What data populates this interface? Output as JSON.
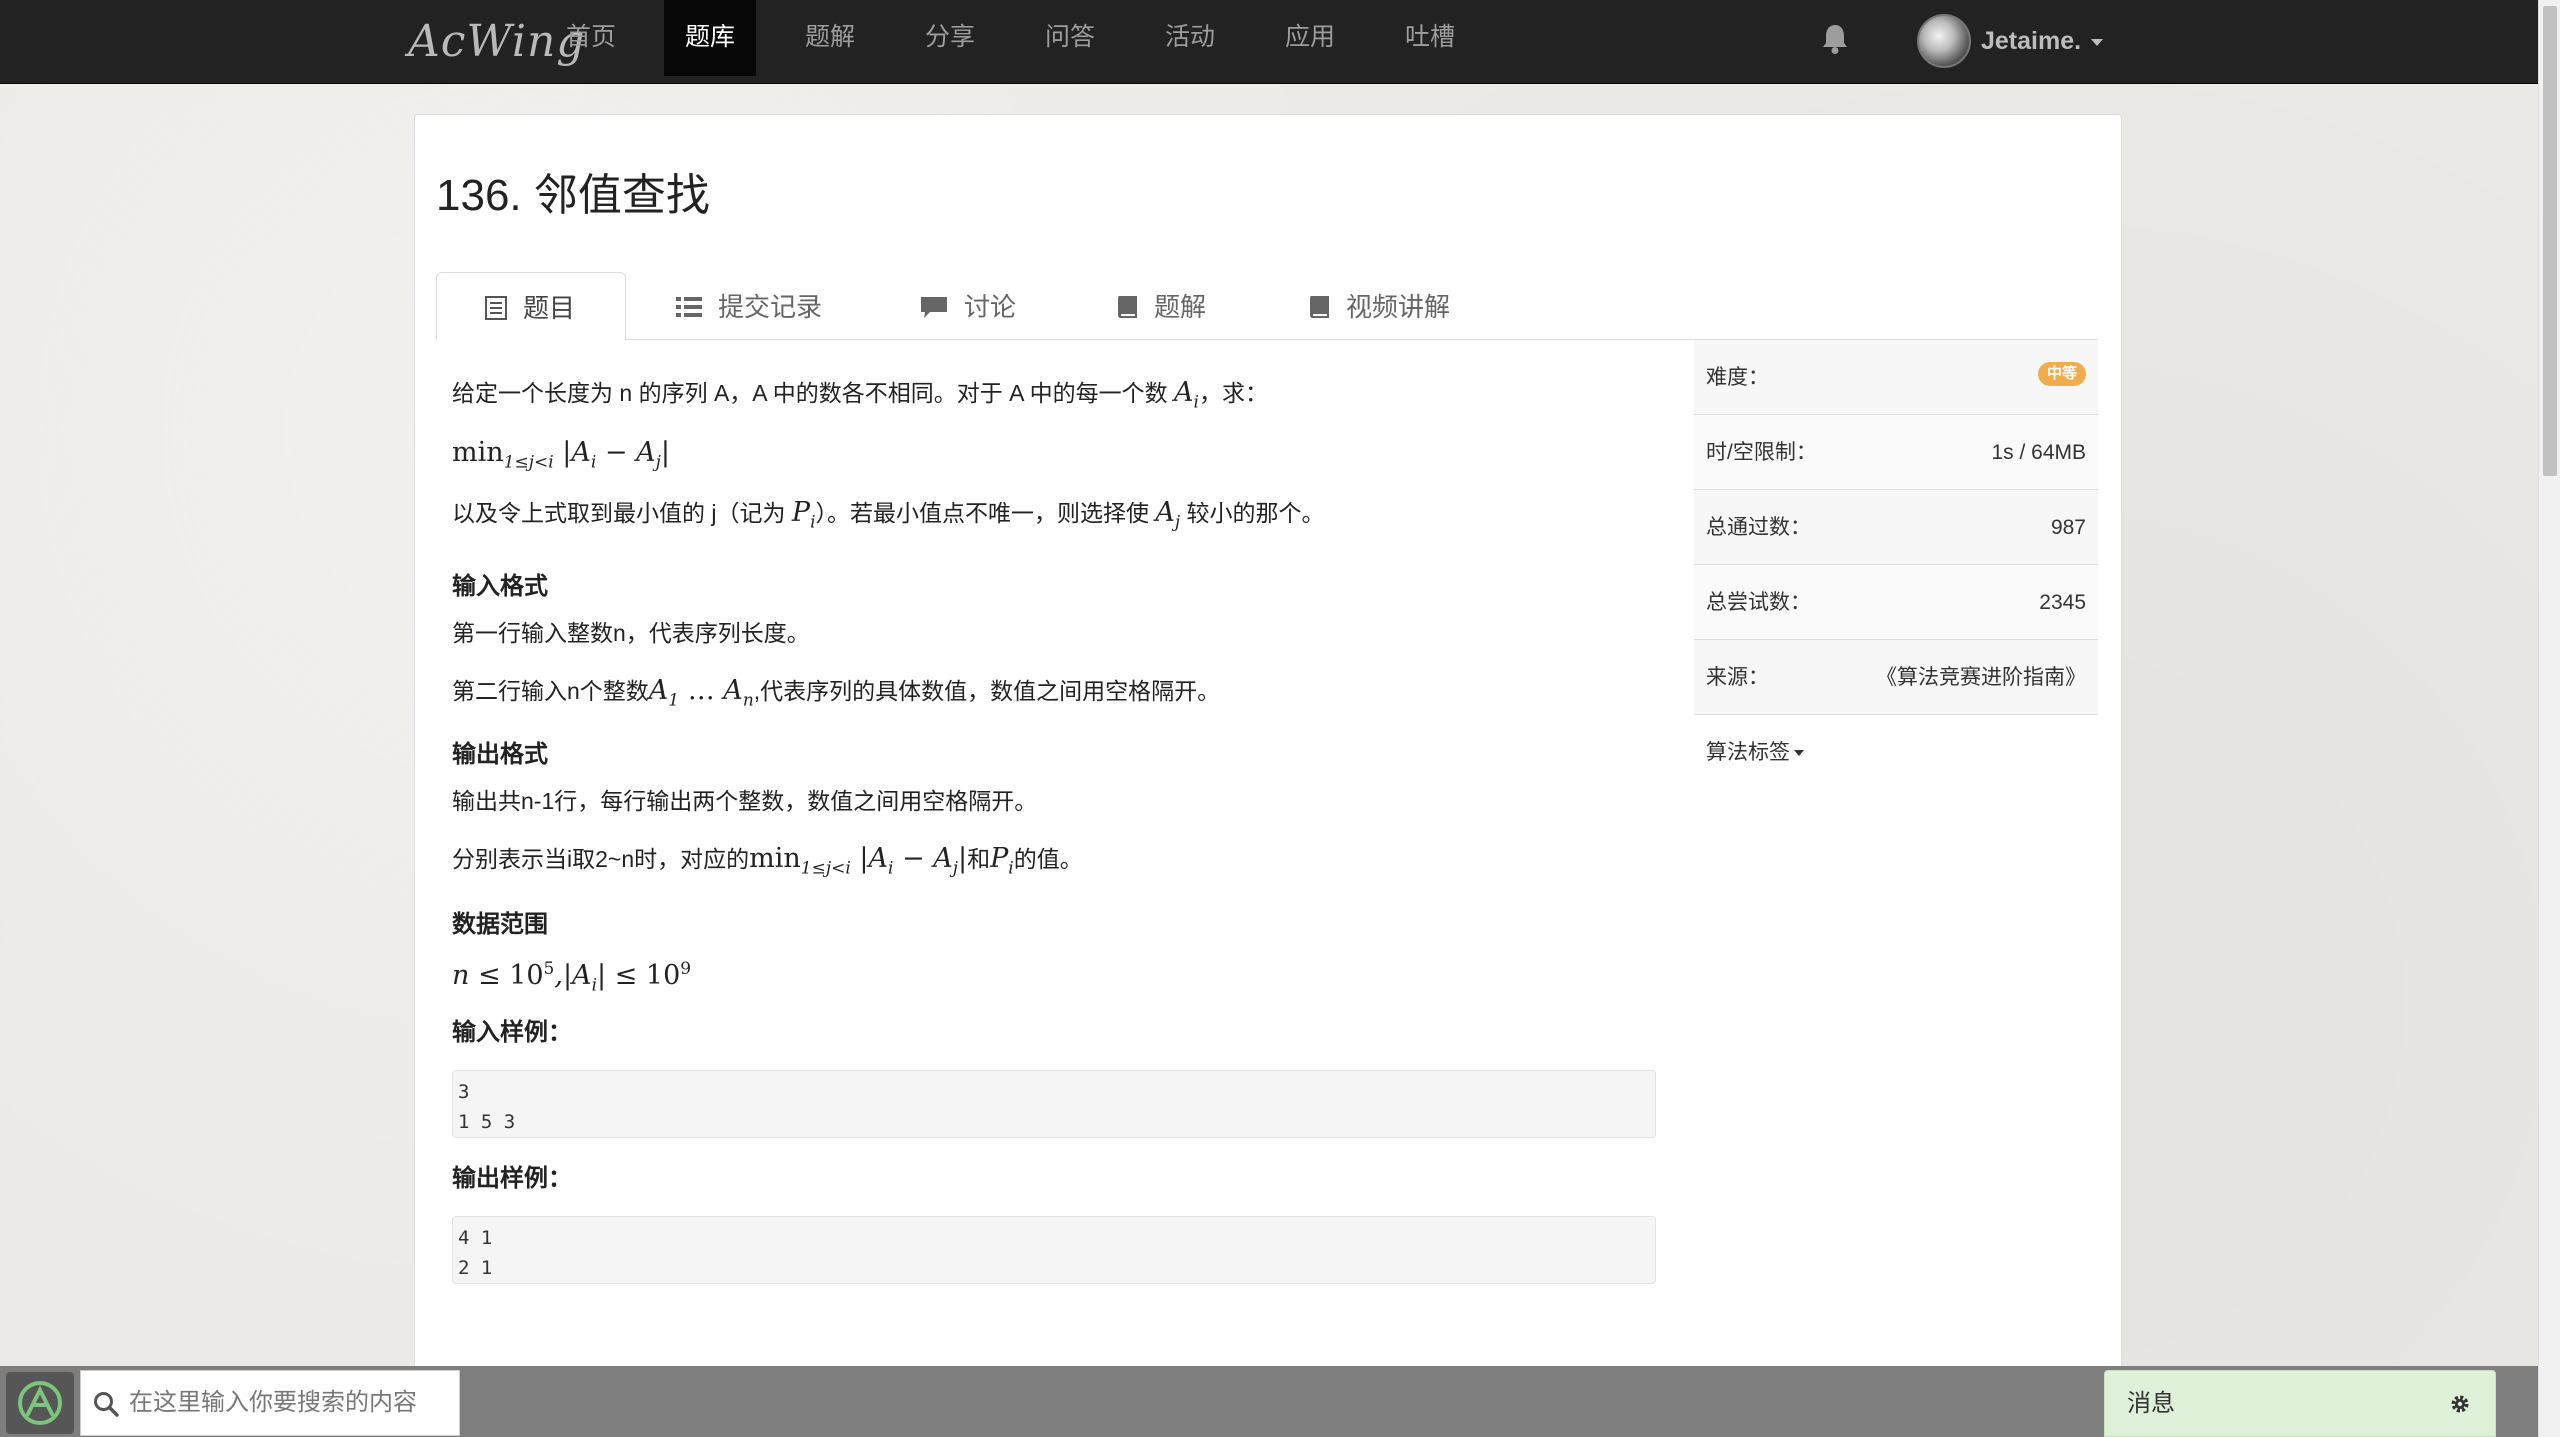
{
  "navbar": {
    "logo": "AcWing",
    "items": [
      "首页",
      "题库",
      "题解",
      "分享",
      "问答",
      "活动",
      "应用",
      "吐槽"
    ],
    "active_index": 1,
    "username": "Jetaime.",
    "icons": {
      "notifications": "bell-icon",
      "dropdown": "caret-down-icon"
    }
  },
  "problem": {
    "title": "136. 邻值查找",
    "tabs": [
      "题目",
      "提交记录",
      "讨论",
      "题解",
      "视频讲解"
    ],
    "tab_icons": [
      "file-text-icon",
      "list-icon",
      "comment-icon",
      "book-icon",
      "book-icon"
    ],
    "active_tab": 0
  },
  "statement": {
    "p1_a": "给定一个长度为 n 的序列 A，A 中的数各不相同。对于 A 中的每一个数 ",
    "p1_b": "，求：",
    "p3_a": "以及令上式取到最小值的 j（记为 ",
    "p3_b": "）。若最小值点不唯一，则选择使 ",
    "p3_c": " 较小的那个。",
    "input_heading": "输入格式",
    "input_l1": "第一行输入整数n，代表序列长度。",
    "input_l2_a": "第二行输入n个整数",
    "input_l2_b": ",代表序列的具体数值，数值之间用空格隔开。",
    "output_heading": "输出格式",
    "output_l1": "输出共n-1行，每行输出两个整数，数值之间用空格隔开。",
    "output_l2_a": "分别表示当i取2~n时，对应的",
    "output_l2_b": "和",
    "output_l2_c": "的值。",
    "range_heading": "数据范围",
    "sample_in_heading": "输入样例：",
    "sample_in": [
      "3",
      "1 5 3"
    ],
    "sample_out_heading": "输出样例：",
    "sample_out": [
      "4 1",
      "2 1"
    ]
  },
  "sidebar": {
    "difficulty_label": "难度：",
    "difficulty_value": "中等",
    "difficulty_color": "#f0ad4e",
    "limit_label": "时/空限制：",
    "limit_value": "1s / 64MB",
    "pass_label": "总通过数：",
    "pass_value": "987",
    "try_label": "总尝试数：",
    "try_value": "2345",
    "source_label": "来源：",
    "source_value": "《算法竞赛进阶指南》",
    "tags_label": "算法标签"
  },
  "bottom": {
    "search_placeholder": "在这里输入你要搜索的内容",
    "messages_label": "消息",
    "icons": {
      "app": "acwing-logo-icon",
      "search": "search-icon",
      "settings": "gear-icon"
    }
  }
}
